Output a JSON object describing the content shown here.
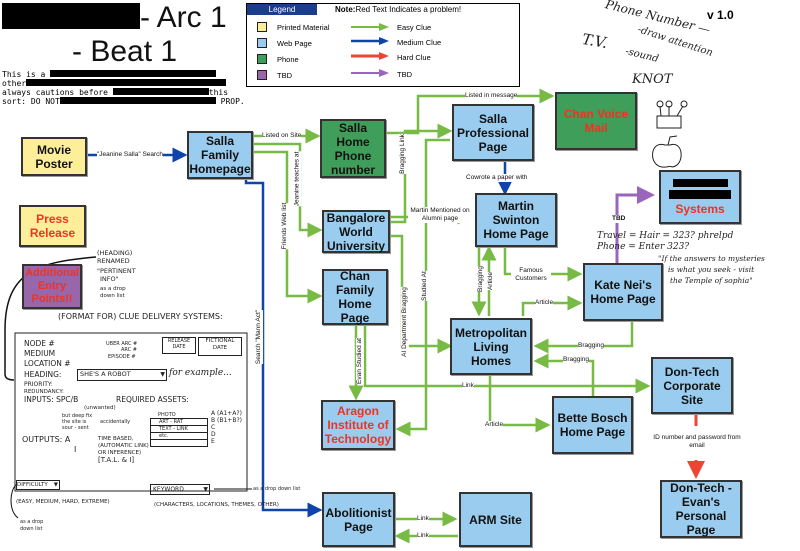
{
  "header": {
    "title_line1_suffix": "- Arc 1",
    "title_line2": "- Beat 1",
    "version": "v 1.0",
    "intro_lines": [
      {
        "prefix": "This is a",
        "suffix": ""
      },
      {
        "prefix": "other",
        "suffix": ""
      },
      {
        "prefix": "always cautions before",
        "suffix": "this"
      },
      {
        "prefix": "sort: DO NOT",
        "suffix": "PROP."
      }
    ]
  },
  "legend": {
    "title": "Legend",
    "note_bold": "Note:",
    "note": "Red Text Indicates a problem!",
    "node_types": [
      {
        "label": "Printed Material",
        "color": "#fdef9a"
      },
      {
        "label": "Web Page",
        "color": "#99ccee"
      },
      {
        "label": "Phone",
        "color": "#3f9e5a"
      },
      {
        "label": "TBD",
        "color": "#9966aa"
      }
    ],
    "clue_types": [
      {
        "label": "Easy Clue",
        "color": "#77bb44"
      },
      {
        "label": "Medium Clue",
        "color": "#1144aa"
      },
      {
        "label": "Hard Clue",
        "color": "#ee4433"
      },
      {
        "label": "TBD",
        "color": "#9966bb"
      }
    ]
  },
  "nodes": {
    "movie_poster": {
      "label": "Movie Poster",
      "type": "print"
    },
    "press_release": {
      "label": "Press Release",
      "type": "print",
      "problem": true
    },
    "additional_entry": {
      "label": "Additional Entry Points!!",
      "type": "tbd",
      "problem": true
    },
    "salla_family": {
      "label": "Salla Family Homepage",
      "type": "web"
    },
    "salla_phone": {
      "label": "Salla Home Phone number",
      "type": "phone"
    },
    "salla_professional": {
      "label": "Salla Professional Page",
      "type": "web"
    },
    "chan_voicemail": {
      "label": "Chan Voice Mail",
      "type": "phone",
      "problem": true
    },
    "bangalore": {
      "label": "Bangalore World University",
      "type": "web"
    },
    "martin_swinton": {
      "label": "Martin Swinton Home Page",
      "type": "web"
    },
    "systems": {
      "label": "Systems",
      "type": "web",
      "problem": true
    },
    "chan_family": {
      "label": "Chan Family Home Page",
      "type": "web"
    },
    "kate_nei": {
      "label": "Kate Nei's Home Page",
      "type": "web"
    },
    "metropolitan": {
      "label": "Metropolitan Living Homes",
      "type": "web"
    },
    "dontech_corp": {
      "label": "Don-Tech Corporate Site",
      "type": "web"
    },
    "aragon": {
      "label": "Aragon Institute of Technology",
      "type": "web",
      "problem": true
    },
    "bette_bosch": {
      "label": "Bette Bosch Home Page",
      "type": "web"
    },
    "dontech_evan": {
      "label": "Don-Tech - Evan's Personal Page",
      "type": "web"
    },
    "abolitionist": {
      "label": "Abolitionist Page",
      "type": "web"
    },
    "arm_site": {
      "label": "ARM Site",
      "type": "web"
    }
  },
  "edge_labels": {
    "jeanine_search": "\"Jeanine Salla\" Search",
    "listed_on_site": "Listed on Site",
    "jeanine_teaches": "Jeanine teaches at",
    "friends_web_list": "Friends Web list",
    "search_mann_act": "Search \"Mann Act\"",
    "listed_in_message": "Listed in message",
    "bragging_link": "Bragging Link",
    "cowrote": "Cowrote a paper with",
    "martin_mentioned": "Martin Mentioned on Alumni page",
    "ai_dept_bragging": "AI Department Bragging",
    "studied_at": "Studied At",
    "evan_studied_at": "Evan Studied at",
    "tbd": "TBD",
    "famous_customers": "Famous Customers",
    "bragging": "Bragging",
    "article": "Article",
    "link": "Link",
    "id_password": "ID number and password from email"
  },
  "annotations": {
    "top_right": [
      "Phone Number —",
      "T.V.",
      "-draw attention",
      "-sound",
      "KNOT"
    ],
    "kate_note": [
      "Travel = Hair = 323? phrelpd",
      "Phone = Enter 323?",
      "\"If the answers to mysteries",
      "is what you seek - visit",
      "the Temple of sophia\""
    ],
    "heading_note": [
      "(HEADING)",
      "RENAMED",
      "\"PERTINENT",
      "INFO\"",
      "as a drop",
      "down list"
    ],
    "form_title": "(FORMAT FOR) CLUE DELIVERY SYSTEMS:",
    "form_fields": {
      "node": "NODE #",
      "medium": "MEDIUM",
      "location": "LOCATION #",
      "uber_arc": "UBER ARC #",
      "arc": "ARC #",
      "episode": "EPISODE #",
      "release_date": "RELEASE DATE",
      "fictional_date": "FICTIONAL DATE",
      "heading_label": "HEADING:",
      "heading_value": "SHE'S A ROBOT",
      "heading_example": "for example...",
      "priority": "PRIORITY:",
      "redundancy": "REDUNDANCY:",
      "inputs": "INPUTS: SPC/B",
      "inputs_notes": [
        "(unwanted)",
        "but deep fix",
        "the site is",
        "sour - sent",
        "accidentally"
      ],
      "required_assets": "REQUIRED ASSETS:",
      "assets": [
        "PHOTO",
        "ART - RAT",
        "TEXT - LINK",
        "etc."
      ],
      "asset_letters": [
        "A (A1+A?)",
        "B (B1+B?)",
        "C",
        "D",
        "E"
      ],
      "outputs": "OUTPUTS: A",
      "outputs_second": "I",
      "time_based": [
        "TIME BASED,",
        "(AUTOMATIC LINK)",
        "OR INFERENCE)",
        "[T.A.L. & I]"
      ],
      "difficulty": "DIFFICULTY",
      "difficulty_options": "(EASY, MEDIUM, HARD, EXTREME)",
      "difficulty_note": [
        "as a drop",
        "down list"
      ],
      "keyword": "KEYWORD",
      "keyword_options": "(CHARACTERS, LOCATIONS, THEMES, OTHER)",
      "keyword_note": "as a drop down list"
    }
  }
}
